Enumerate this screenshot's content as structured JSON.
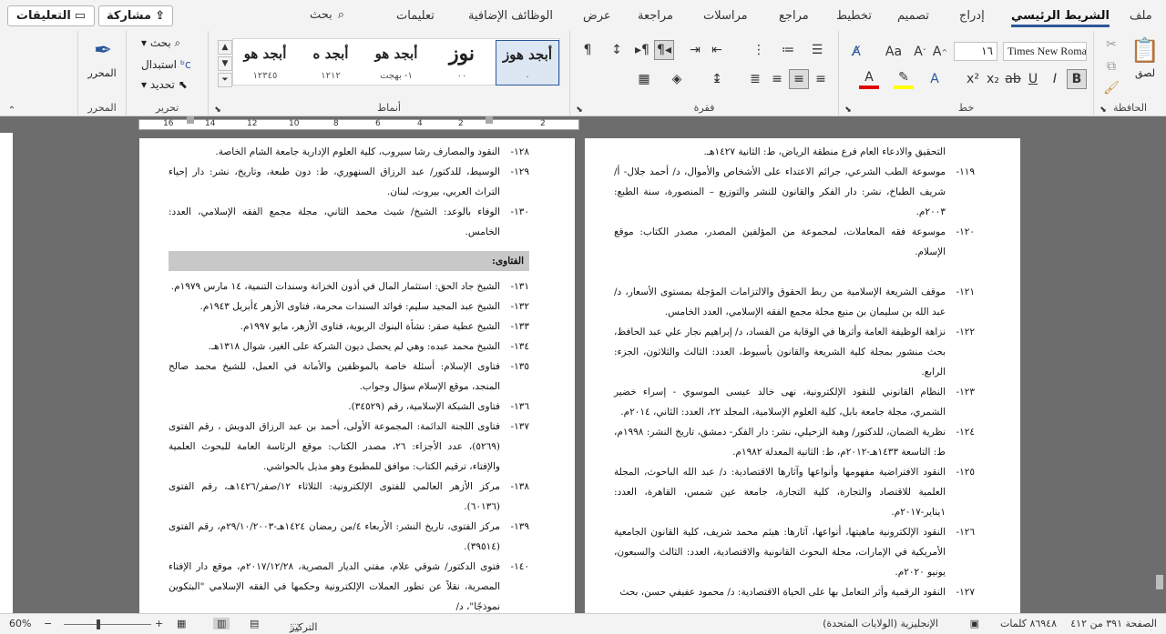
{
  "ribbon_tabs": [
    {
      "label": "ملف"
    },
    {
      "label": "الشريط الرئيسي"
    },
    {
      "label": "إدراج"
    },
    {
      "label": "تصميم"
    },
    {
      "label": "تخطيط"
    },
    {
      "label": "مراجع"
    },
    {
      "label": "مراسلات"
    },
    {
      "label": "مراجعة"
    },
    {
      "label": "عرض"
    },
    {
      "label": "الوظائف الإضافية"
    },
    {
      "label": "تعليمات"
    }
  ],
  "search_label": "بحث",
  "share_label": "مشاركة",
  "comments_label": "التعليقات",
  "groups": {
    "clipboard": "الحافظة",
    "font": "خط",
    "paragraph": "فقرة",
    "styles": "أنماط",
    "editing": "تحرير",
    "editor": "المحرر"
  },
  "clipboard": {
    "paste_label": "لصق"
  },
  "font": {
    "name": "Times New Roman",
    "size": "١٦"
  },
  "editing": {
    "find": "بحث",
    "replace": "استبدال",
    "select": "تحديد"
  },
  "editor": {
    "label": "المحرر"
  },
  "styles": [
    {
      "name": "أبجد هوز",
      "sub": "٠"
    },
    {
      "name": "نوز",
      "sub": "٠٠"
    },
    {
      "name": "أبجد هو",
      "sub": "١- بهجت"
    },
    {
      "name": "أبجد ه",
      "sub": "١٢١٢"
    },
    {
      "name": "أبجد هو",
      "sub": "١٢٣٤٥"
    }
  ],
  "ruler_numbers": [
    "2",
    "2",
    "4",
    "6",
    "8",
    "10",
    "12",
    "14",
    "16"
  ],
  "left_page": {
    "refs_top": [
      {
        "num": "١٢٨-",
        "text": "النقود والمصارف رشا سيروب، كلية العلوم الإدارية جامعة الشام الخاصة."
      },
      {
        "num": "١٢٩-",
        "text": "الوسيط، للدكتور/ عبد الرزاق السنهوري، ط: دون طبعة، وتاريخ، نشر: دار إحياء التراث العربي، بيروت، لبنان."
      },
      {
        "num": "١٣٠-",
        "text": "الوفاء بالوعد: الشيخ/ شيث محمد الثاني، مجلة مجمع الفقه الإسلامي، العدد: الخامس."
      }
    ],
    "section_title": "الفتاوى:",
    "refs": [
      {
        "num": "١٣١-",
        "text": "الشيخ جاد الحق: استثمار المال في أذون الخزانة وسندات التنمية، ١٤ مارس ١٩٧٩م."
      },
      {
        "num": "١٣٢-",
        "text": "الشيخ عبد المجيد سليم: فوائد السندات محرمة، فتاوى الأزهر ٤أبريل ١٩٤٣م."
      },
      {
        "num": "١٣٣-",
        "text": "الشيخ عطية صقر: نشأة البنوك الربوية، فتاوى الأزهر، مايو ١٩٩٧م."
      },
      {
        "num": "١٣٤-",
        "text": "الشيخ محمد عبده: وهي لم يحصل ديون الشركة على الغير، شوال ١٣١٨هـ."
      },
      {
        "num": "١٣٥-",
        "text": "فتاوى الإسلام: أسئلة خاصة بالموظفين والأمانة في العمل، للشيخ محمد صالح المنجد، موقع الإسلام سؤال وجواب."
      },
      {
        "num": "١٣٦-",
        "text": "فتاوى الشبكة الإسلامية، رقم (٣٤٥٢٩)."
      },
      {
        "num": "١٣٧-",
        "text": "فتاوى اللجنة الدائمة: المجموعة الأولى، أحمد بن عبد الرزاق الدويش ، رقم الفتوى (٥٢٦٩)، عدد الأجزاء: ٢٦، مصدر الكتاب: موقع الرئاسة العامة للبحوث العلمية والإفتاء، ترقيم الكتاب: موافق للمطبوع وهو مذيل بالحواشي."
      },
      {
        "num": "١٣٨-",
        "text": "مركز الأزهر العالمي للفتوى الإلكترونية: الثلاثاء ١٢/صفر/١٤٢٦هـ، رقم الفتوى (٦٠١٣٦)."
      },
      {
        "num": "١٣٩-",
        "text": "مركز الفتوى، تاريخ النشر: الأربعاء ٤/من رمضان ١٤٢٤هـ-٢٩/١٠/٢٠٠٣م، رقم الفتوى (٣٩٥١٤)."
      },
      {
        "num": "١٤٠-",
        "text": "فتوى الدكتور/ شوقي علام، مفتي الديار المصرية، ٢٠١٧/١٢/٢٨م، موقع دار الإفتاء المصرية، نقلاً عن تطور العملات الإلكترونية وحكمها في الفقه الإسلامي \"البتكوين نموذجًا\"، د/"
      }
    ]
  },
  "right_page": {
    "refs": [
      {
        "num": "",
        "text": "التحقيق والادعاء العام فرع منطقة الرياض، ط: الثانية ١٤٢٧هـ."
      },
      {
        "num": "١١٩-",
        "text": "موسوعة الطب الشرعي، جرائم الاعتداء على الأشخاص والأموال، د/ أحمد جلال- أ/ شريف الطباخ، نشر: دار الفكر والقانون للنشر والتوزيع – المنصورة، سنة الطبع: ٢٠٠٣م."
      },
      {
        "num": "١٢٠-",
        "text": "موسوعة فقه المعاملات، لمجموعة من المؤلفين المصدر، مصدر الكتاب: موقع الإسلام."
      },
      {
        "num": "",
        "text": ""
      },
      {
        "num": "١٢١-",
        "text": "موقف الشريعة الإسلامية من ربط الحقوق والالتزامات المؤجلة بمستوى الأسعار، د/ عبد الله بن سليمان بن منيع مجلة مجمع الفقه الإسلامي، العدد الخامس."
      },
      {
        "num": "١٢٢-",
        "text": "نزاهة الوظيفة العامة وأثرها في الوقاية من الفساد، د/ إبراهيم نجار علي عبد الحافظ، بحث منشور بمجلة كلية الشريعة والقانون بأسيوط، العدد: الثالث والثلاثون، الجزء: الرابع."
      },
      {
        "num": "١٢٣-",
        "text": "النظام القانوني للنقود الإلكترونية، نهى خالد عيسى الموسوي - إسراء خضير الشمري، مجلة جامعة بابل، كلية العلوم الإسلامية، المجلد ٢٢، العدد: الثاني، ٢٠١٤م."
      },
      {
        "num": "١٢٤-",
        "text": "نظرية الضمان، للدكتور/ وهبة الزحيلي، نشر: دار الفكر- دمشق، تاريخ النشر: ١٩٩٨م، ط: التاسعة ١٤٣٣هـ-٢٠١٢م، ط: الثانية المعدلة ١٩٨٢م."
      },
      {
        "num": "١٢٥-",
        "text": "النقود الافتراضية مفهومها وأنواعها وآثارها الاقتصادية: د/ عبد الله الباحوث، المجلة العلمية للاقتصاد والتجارة، كلية التجارة، جامعة عين شمس، القاهرة، العدد: ١يناير-٢٠١٧م."
      },
      {
        "num": "١٢٦-",
        "text": "النقود الإلكترونية ماهيتها، أنواعها، آثارها: هيثم محمد شريف، كلية القانون الجامعية الأمريكية في الإمارات، مجلة البحوث القانونية والاقتصادية، العدد: الثالث والسبعون، يونيو ٢٠٢٠م."
      },
      {
        "num": "١٢٧-",
        "text": "النقود الرقمية وأثر التعامل بها على الحياة الاقتصادية: د/ محمود عفيفي حسن، بحث"
      }
    ]
  },
  "status": {
    "page": "الصفحة ٣٩١ من ٤١٢",
    "words": "٨٦٩٤٨ كلمات",
    "language": "الإنجليزية (الولايات المتحدة)",
    "focus": "التركيز",
    "zoom": "60%"
  },
  "colors": {
    "accent": "#2b579a",
    "ribbon_bg": "#f3f3f3",
    "workspace": "#6d6d6d"
  }
}
